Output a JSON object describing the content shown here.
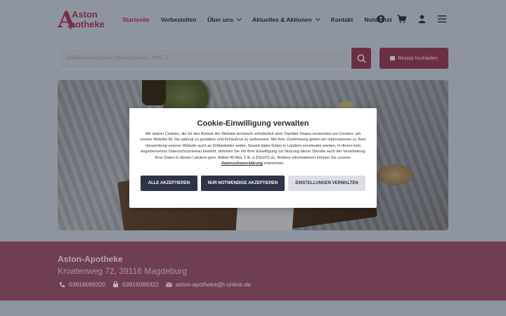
{
  "header": {
    "logo_line1": "Aston",
    "logo_line2": "potheke",
    "logo_letter": "A",
    "nav": [
      {
        "label": "Startseite",
        "active": true
      },
      {
        "label": "Vorbestellen"
      },
      {
        "label": "Über uns",
        "dropdown": true
      },
      {
        "label": "Aktuelles & Aktionen",
        "dropdown": true
      },
      {
        "label": "Kontakt"
      },
      {
        "label": "Notdienst"
      }
    ],
    "icons": [
      "accessibility-icon",
      "cart-icon",
      "user-icon",
      "menu-icon"
    ]
  },
  "search": {
    "placeholder": "Medikament suchen (Produktname, PZN...)",
    "prescription_label": "Rezept hochladen"
  },
  "cookie": {
    "title": "Cookie-Einwilligung verwalten",
    "text": "Wir setzen Cookies, die für den Betrieb der Website technisch erforderlich sind. Darüber hinaus verwenden wir Cookies, um unsere Website für Sie optimal zu gestalten und fortlaufend zu verbessern. Mit Ihrer Zustimmung geben wir Informationen zu Ihrer Verwendung unserer Website auch an Drittanbieter weiter. Soweit dabei Daten in Ländern verarbeitet werden, in denen kein angemessenes Datenschutzniveau besteht, stimmen Sie mit Ihrer Einwilligung zur Nutzung dieser Dienste auch der Verarbeitung Ihrer Daten in diesen Ländern gem. Artikel 49 Abs. 1 lit. a DSGVO zu. Weitere Informationen können Sie unserer",
    "link": "Datenschutzerklärung",
    "text_end": "entnehmen.",
    "accept_all": "Alle akzeptieren",
    "accept_necessary": "Nur notwendige akzeptieren",
    "settings": "Einstellungen verwalten"
  },
  "footer": {
    "name": "Aston-Apotheke",
    "address": "Kroatenweg 72, 39116 Magdeburg",
    "phone": "03916099320",
    "fax": "03916099322",
    "email": "aston-apotheke@t-online.de"
  },
  "colors": {
    "brand": "#7a2d45",
    "footer": "#6f3e52",
    "button_dark": "#2e3446"
  }
}
